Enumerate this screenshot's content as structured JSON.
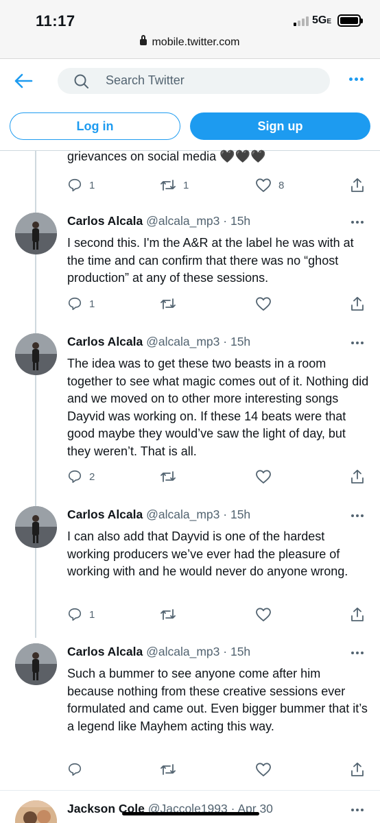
{
  "status_bar": {
    "time": "11:17",
    "network": "5G",
    "network_suffix": "E"
  },
  "browser": {
    "url": "mobile.twitter.com"
  },
  "header": {
    "search_placeholder": "Search Twitter",
    "login_label": "Log in",
    "signup_label": "Sign up"
  },
  "top_tweet": {
    "text": "grievances on social media 🖤🖤🖤",
    "replies": "1",
    "retweets": "1",
    "likes": "8"
  },
  "tweets": [
    {
      "name": "Carlos Alcala",
      "handle": "@alcala_mp3",
      "time": "· 15h",
      "text": "I second this. I'm the A&R at the label he was with at the time and can confirm that there was no “ghost production” at any of these sessions.",
      "replies": "1",
      "retweets": "",
      "likes": ""
    },
    {
      "name": "Carlos Alcala",
      "handle": "@alcala_mp3",
      "time": "· 15h",
      "text": "The idea was to get these two beasts in a room together to see what magic comes out of it. Nothing did and we moved on to other more interesting songs Dayvid was working on. If these 14 beats were that good maybe they would’ve saw the light of day, but they weren’t. That is all.",
      "replies": "2",
      "retweets": "",
      "likes": ""
    },
    {
      "name": "Carlos Alcala",
      "handle": "@alcala_mp3",
      "time": "· 15h",
      "text": "I can also add that Dayvid is one of the hardest working producers we’ve ever had the pleasure of working with and he would never do anyone wrong.",
      "replies": "1",
      "retweets": "",
      "likes": ""
    },
    {
      "name": "Carlos Alcala",
      "handle": "@alcala_mp3",
      "time": "· 15h",
      "text": "Such a bummer to see anyone come after him because nothing from these creative sessions ever formulated and came out. Even bigger bummer that it’s a legend like Mayhem acting this way.",
      "replies": "",
      "retweets": "",
      "likes": ""
    }
  ],
  "next_tweet": {
    "name": "Jackson Cole",
    "handle": "@Jaccole1993",
    "time": "· Apr 30"
  },
  "colors": {
    "accent": "#1d9bf0",
    "text": "#0f1419",
    "muted": "#536471",
    "border": "#cfd9de"
  }
}
